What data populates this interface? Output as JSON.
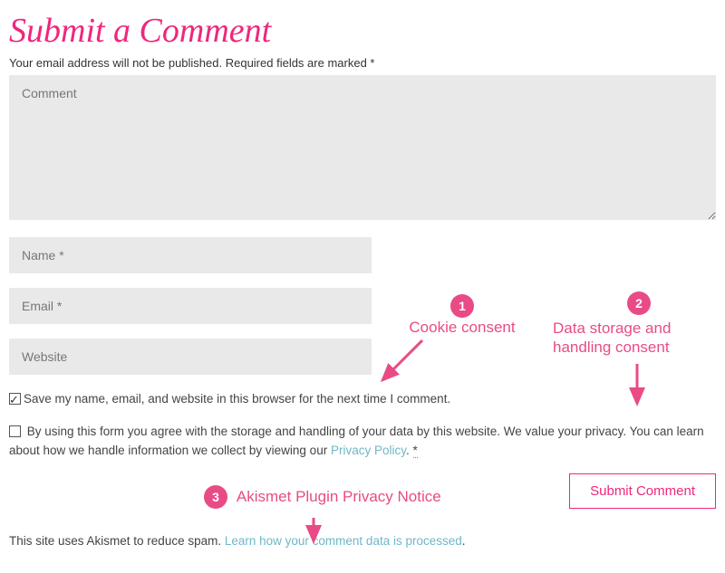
{
  "title": "Submit a Comment",
  "required_note": "Your email address will not be published. Required fields are marked *",
  "fields": {
    "comment_placeholder": "Comment",
    "name_placeholder": "Name *",
    "email_placeholder": "Email *",
    "website_placeholder": "Website"
  },
  "consent_cookie": {
    "checked": true,
    "label": "Save my name, email, and website in this browser for the next time I comment."
  },
  "consent_data": {
    "checked": false,
    "prefix": " By using this form you agree with the storage and handling of your data by this website. We value your privacy. You can learn about how we handle information we collect by viewing our ",
    "link_text": "Privacy Policy",
    "suffix": ". ",
    "ast": "*"
  },
  "submit_label": "Submit Comment",
  "akismet": {
    "prefix": "This site uses Akismet to reduce spam. ",
    "link_text": "Learn how your comment data is processed",
    "suffix": "."
  },
  "annotations": {
    "c1": {
      "num": "1",
      "label": "Cookie consent"
    },
    "c2": {
      "num": "2",
      "label": "Data storage and handling consent"
    },
    "c3": {
      "num": "3",
      "label": "Akismet Plugin Privacy Notice"
    }
  }
}
